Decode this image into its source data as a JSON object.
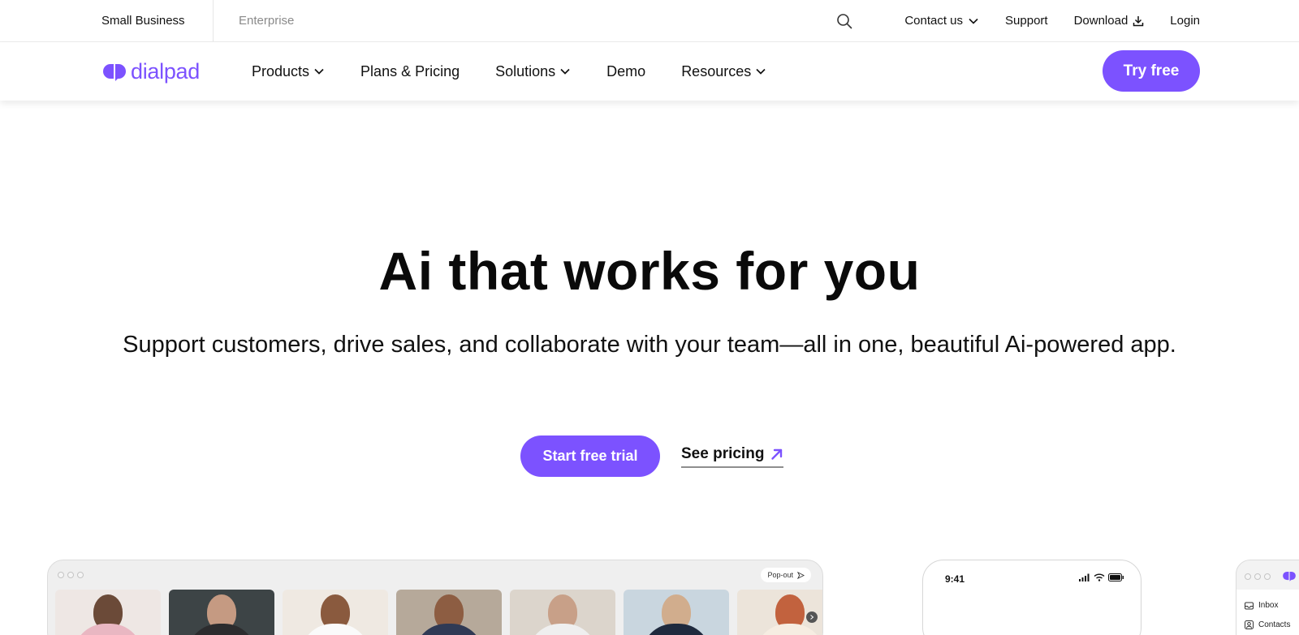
{
  "utility_bar": {
    "segments": [
      "Small Business",
      "Enterprise"
    ],
    "links": {
      "contact": "Contact us",
      "support": "Support",
      "download": "Download",
      "login": "Login"
    }
  },
  "nav": {
    "logo_text": "dialpad",
    "items": [
      "Products",
      "Plans & Pricing",
      "Solutions",
      "Demo",
      "Resources"
    ],
    "cta": "Try free"
  },
  "hero": {
    "title": "Ai that works for you",
    "subtitle": "Support customers, drive sales, and collaborate with your team—all in one, beautiful Ai-powered app.",
    "primary_cta": "Start free trial",
    "secondary_cta": "See pricing"
  },
  "preview": {
    "popout_label": "Pop-out",
    "phone_time": "9:41",
    "side_items": [
      "Inbox",
      "Contacts"
    ]
  },
  "colors": {
    "brand": "#7c52ff",
    "text": "#111111",
    "muted": "#8a8a8a"
  }
}
